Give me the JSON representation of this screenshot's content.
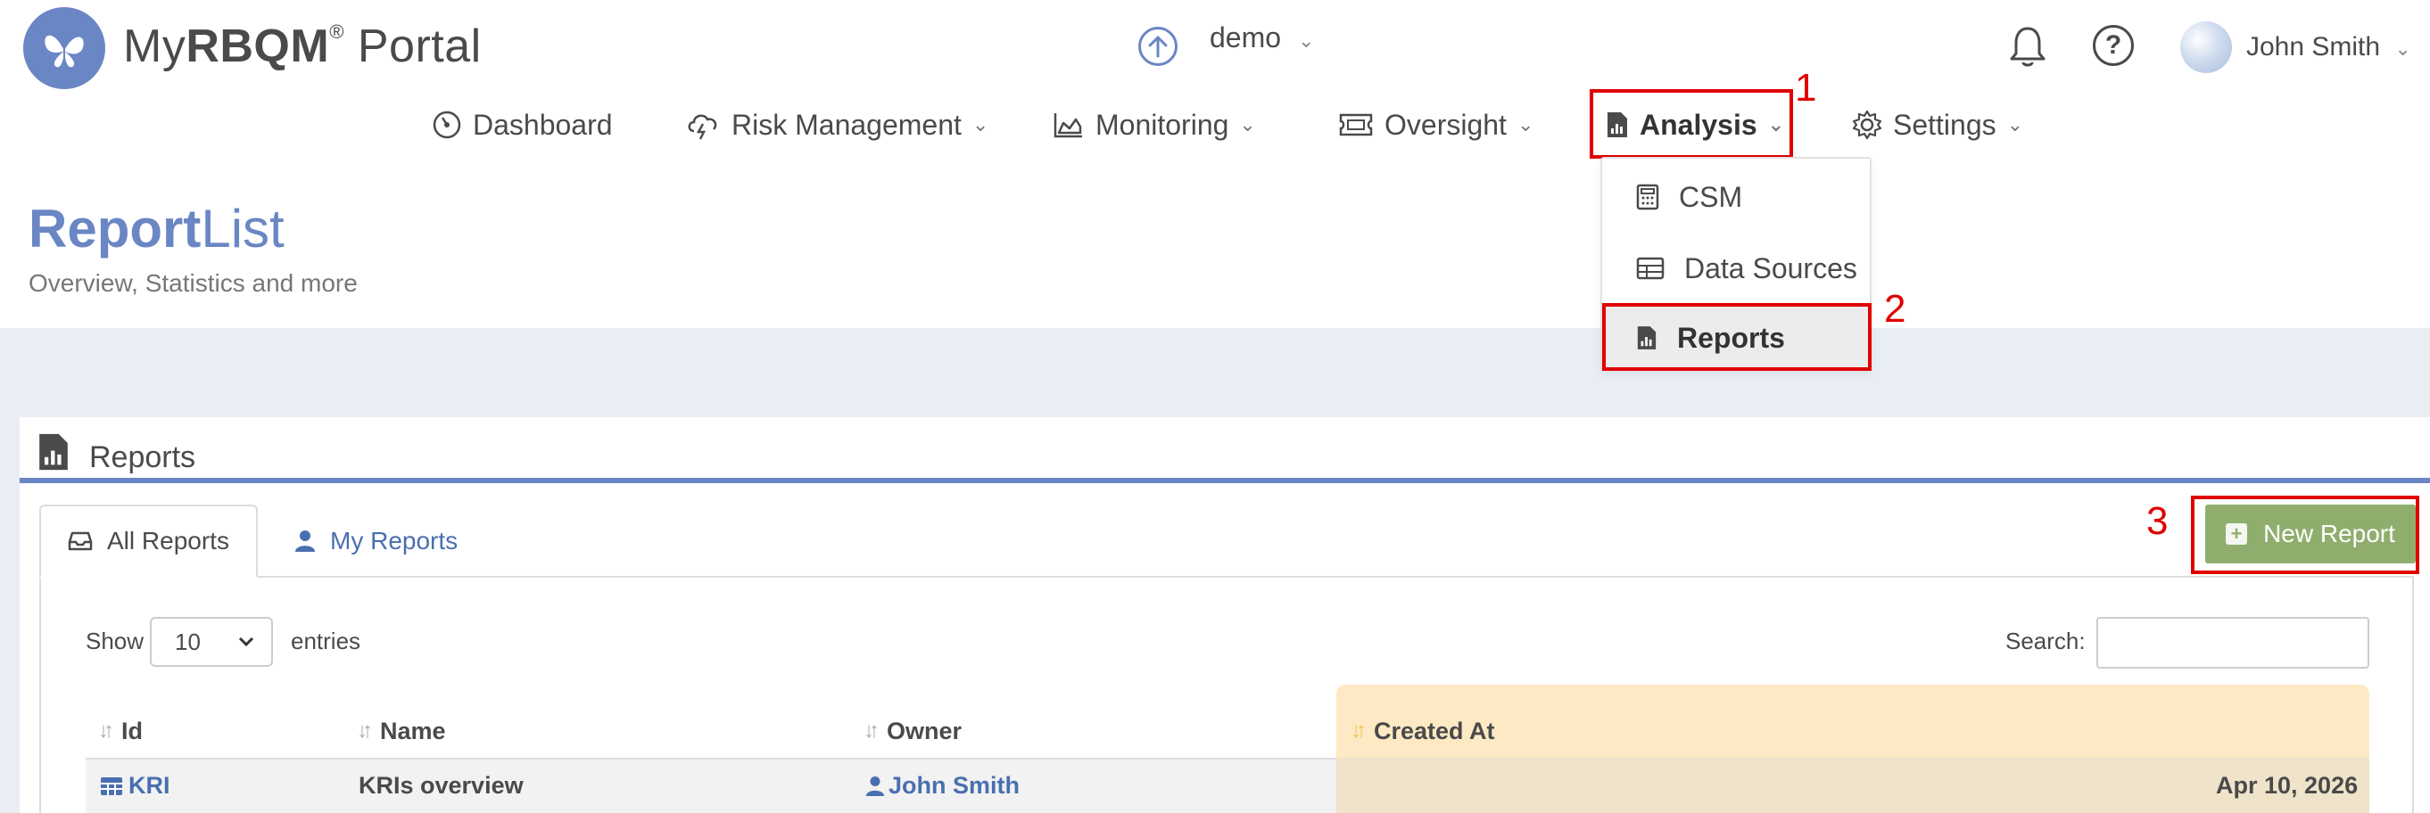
{
  "header": {
    "brand_prefix": "My",
    "brand_bold": "RBQM",
    "brand_reg": "®",
    "brand_suffix": " Portal",
    "env_label": "demo",
    "user_name": "John Smith",
    "icons": [
      "upload-circle-icon",
      "bell-icon",
      "help-icon",
      "avatar"
    ]
  },
  "nav": {
    "items": [
      {
        "label": "Dashboard",
        "icon": "dashboard-gauge-icon"
      },
      {
        "label": "Risk Management",
        "icon": "cloud-lightning-icon"
      },
      {
        "label": "Monitoring",
        "icon": "area-chart-icon"
      },
      {
        "label": "Oversight",
        "icon": "ticket-icon"
      },
      {
        "label": "Analysis",
        "icon": "file-chart-icon"
      },
      {
        "label": "Settings",
        "icon": "gear-icon"
      }
    ]
  },
  "dropdown": {
    "items": [
      {
        "label": "CSM",
        "icon": "calculator-icon"
      },
      {
        "label": "Data Sources",
        "icon": "table-icon"
      },
      {
        "label": "Reports",
        "icon": "file-chart-icon"
      }
    ]
  },
  "annotations": [
    "1",
    "2",
    "3"
  ],
  "page": {
    "title_bold": "Report",
    "title_light": "List",
    "subtitle": "Overview, Statistics and more"
  },
  "panel": {
    "title": "Reports",
    "tabs": [
      {
        "label": "All Reports",
        "icon": "inbox-icon"
      },
      {
        "label": "My Reports",
        "icon": "user-icon"
      }
    ],
    "new_button": "New Report",
    "show_label": "Show",
    "page_size": "10",
    "entries_label": "entries",
    "search_label": "Search:"
  },
  "table": {
    "columns": [
      "Id",
      "Name",
      "Owner",
      "Created At"
    ],
    "rows": [
      {
        "id": "KRI",
        "name": "KRIs overview",
        "owner": "John Smith",
        "created_at": "Apr 10, 2026"
      }
    ]
  },
  "colors": {
    "accent": "#6a86c4",
    "annotation": "#e00000",
    "button_green": "#8fae6e",
    "sort_highlight": "#fde9c4"
  }
}
